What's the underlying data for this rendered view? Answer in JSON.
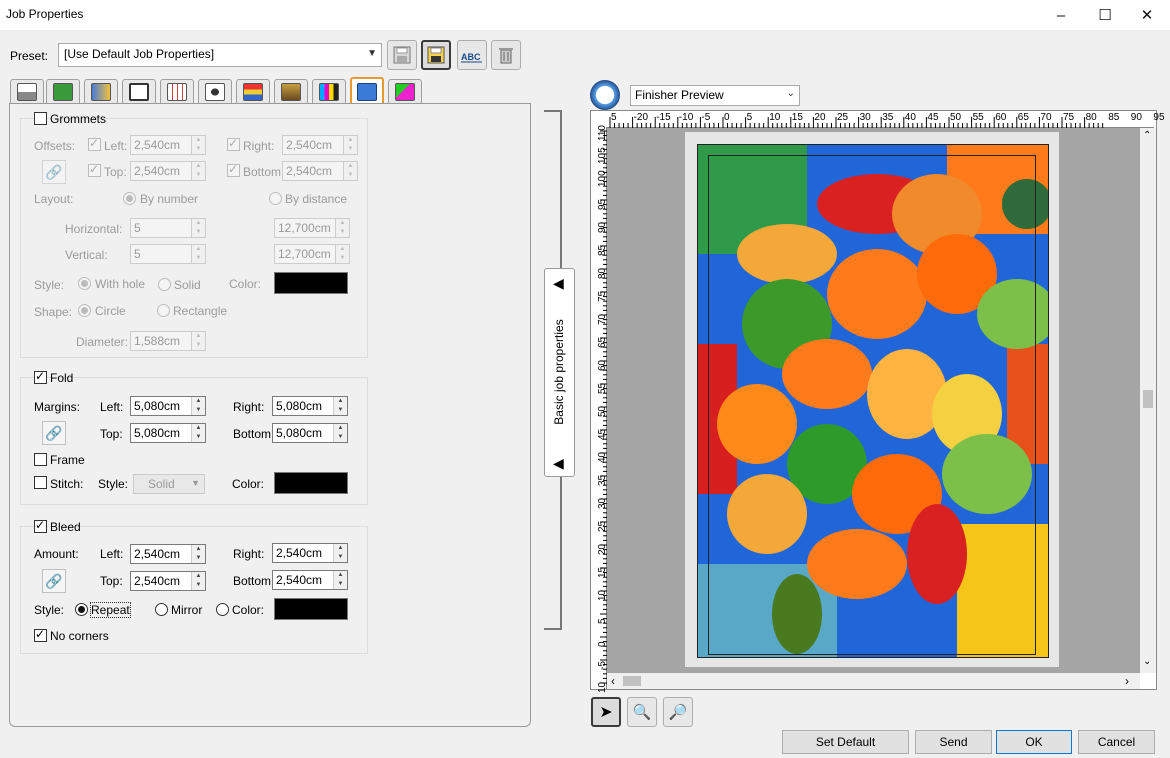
{
  "window": {
    "title": "Job Properties",
    "controls": [
      "–",
      "☐",
      "✕"
    ]
  },
  "preset": {
    "label": "Preset:",
    "value": "[Use Default Job Properties]"
  },
  "grommets": {
    "title": "Grommets",
    "offsets_label": "Offsets:",
    "left_label": "Left:",
    "left_value": "2,540cm",
    "right_label": "Right:",
    "right_value": "2,540cm",
    "top_label": "Top:",
    "top_value": "2,540cm",
    "bottom_label": "Bottom:",
    "bottom_value": "2,540cm",
    "layout_label": "Layout:",
    "by_number": "By number",
    "by_distance": "By distance",
    "horizontal_label": "Horizontal:",
    "horizontal_value": "5",
    "horizontal_distance": "12,700cm",
    "vertical_label": "Vertical:",
    "vertical_value": "5",
    "vertical_distance": "12,700cm",
    "style_label": "Style:",
    "with_hole": "With hole",
    "solid": "Solid",
    "color_label": "Color:",
    "shape_label": "Shape:",
    "circle": "Circle",
    "rectangle": "Rectangle",
    "diameter_label": "Diameter:",
    "diameter_value": "1,588cm"
  },
  "fold": {
    "title": "Fold",
    "margins_label": "Margins:",
    "left_label": "Left:",
    "left_value": "5,080cm",
    "right_label": "Right:",
    "right_value": "5,080cm",
    "top_label": "Top:",
    "top_value": "5,080cm",
    "bottom_label": "Bottom:",
    "bottom_value": "5,080cm",
    "frame_label": "Frame",
    "stitch_label": "Stitch:",
    "style_label": "Style:",
    "style_value": "Solid",
    "color_label": "Color:"
  },
  "bleed": {
    "title": "Bleed",
    "amount_label": "Amount:",
    "left_label": "Left:",
    "left_value": "2,540cm",
    "right_label": "Right:",
    "right_value": "2,540cm",
    "top_label": "Top:",
    "top_value": "2,540cm",
    "bottom_label": "Bottom:",
    "bottom_value": "2,540cm",
    "style_label": "Style:",
    "repeat": "Repeat",
    "mirror": "Mirror",
    "color": "Color:",
    "no_corners": "No corners"
  },
  "splitter": {
    "label": "Basic job properties"
  },
  "preview": {
    "mode": "Finisher Preview",
    "hruler": [
      "5",
      "-20",
      "-15",
      "-10",
      "-5",
      "0",
      "5",
      "10",
      "15",
      "20",
      "25",
      "30",
      "35",
      "40",
      "45",
      "50",
      "55",
      "60",
      "65",
      "70",
      "75",
      "80",
      "85",
      "90",
      "95"
    ],
    "vruler": [
      "110",
      "105",
      "100",
      "95",
      "90",
      "85",
      "80",
      "75",
      "70",
      "65",
      "60",
      "55",
      "50",
      "45",
      "40",
      "35",
      "30",
      "25",
      "20",
      "15",
      "10",
      "5",
      "0",
      "-5",
      "10"
    ]
  },
  "footer": {
    "set_default": "Set Default",
    "send": "Send",
    "ok": "OK",
    "cancel": "Cancel"
  },
  "colors": {
    "accent_tab": "#e59b2e",
    "swatch": "#000000"
  }
}
